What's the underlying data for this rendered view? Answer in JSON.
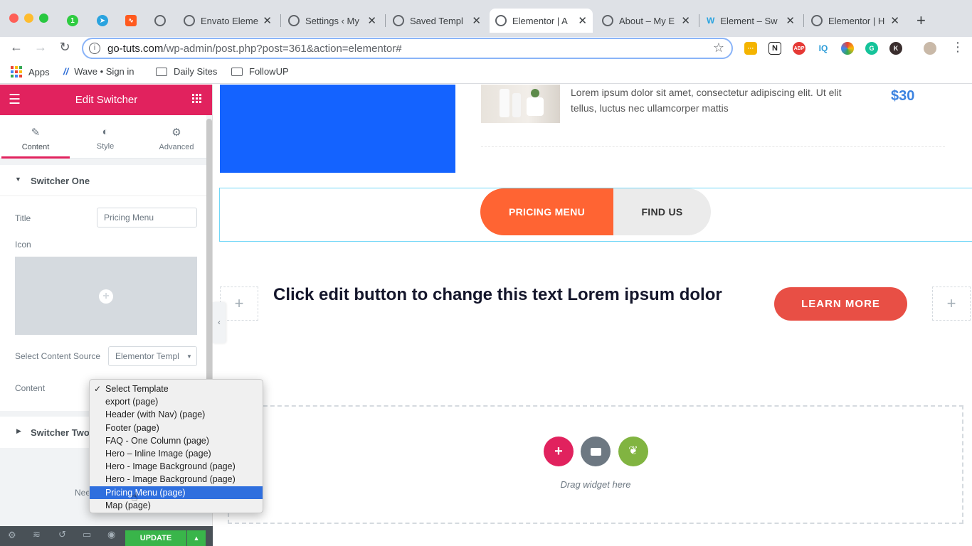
{
  "browser": {
    "tabs": [
      {
        "title": "Envato Eleme",
        "active": false
      },
      {
        "title": "Settings ‹ My",
        "active": false
      },
      {
        "title": "Saved Templ",
        "active": false
      },
      {
        "title": "Elementor | A",
        "active": true
      },
      {
        "title": "About – My E",
        "active": false
      },
      {
        "title": "Element – Sw",
        "active": false
      },
      {
        "title": "Elementor | H",
        "active": false
      }
    ],
    "pinned": [
      "1"
    ],
    "url_host": "go-tuts.com",
    "url_path": "/wp-admin/post.php?post=361&action=elementor#",
    "extensions": [
      "ABP",
      "IQ",
      "N"
    ],
    "bookmarks": {
      "apps": "Apps",
      "wave": "Wave • Sign in",
      "daily": "Daily Sites",
      "followup": "FollowUP"
    }
  },
  "panel": {
    "title": "Edit Switcher",
    "tabs": {
      "content": "Content",
      "style": "Style",
      "advanced": "Advanced"
    },
    "section_one": "Switcher One",
    "title_label": "Title",
    "title_value": "Pricing Menu",
    "icon_label": "Icon",
    "source_label": "Select Content Source",
    "source_value": "Elementor Templ",
    "content_label": "Content",
    "section_two": "Switcher Two",
    "need_help": "Nee",
    "update": "UPDATE"
  },
  "dropdown": {
    "options": [
      "Select Template",
      "export (page)",
      "Header (with Nav) (page)",
      "Footer (page)",
      "FAQ - One Column (page)",
      "Hero – Inline Image (page)",
      "Hero - Image Background (page)",
      "Hero - Image Background (page)",
      "Pricing Menu (page)",
      "Map (page)"
    ],
    "checked_index": 0,
    "highlighted_index": 8
  },
  "canvas": {
    "product_desc": "Lorem ipsum dolor sit amet, consectetur adipiscing elit. Ut elit tellus, luctus nec ullamcorper mattis",
    "price": "$30",
    "switch_tab_active": "PRICING MENU",
    "switch_tab_inactive": "FIND US",
    "headline": "Click edit button to change this text Lorem ipsum dolor",
    "cta": "LEARN MORE",
    "drag_hint": "Drag widget here",
    "colors": {
      "accent": "#e1225e",
      "switch_active": "#ff6433",
      "cta": "#e84f45",
      "price": "#3c83e0",
      "blue_block": "#1463ff"
    }
  }
}
